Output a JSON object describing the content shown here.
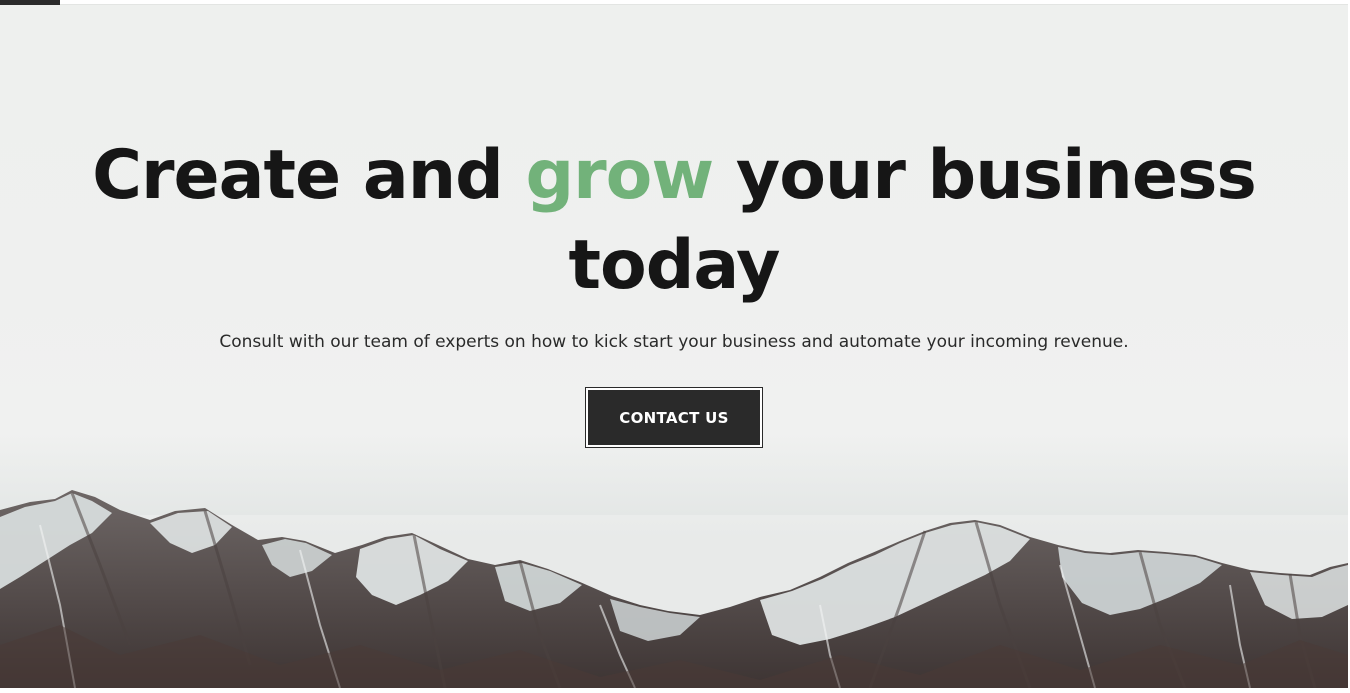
{
  "hero": {
    "headline_part1": "Create and ",
    "headline_accent": "grow",
    "headline_part2": " your business today",
    "subtitle": "Consult with our team of experts on how to kick start your business and automate your incoming revenue.",
    "cta_label": "CONTACT US"
  },
  "colors": {
    "accent": "#72b27a",
    "headline": "#161616",
    "button_bg": "#2a2a2a",
    "button_text": "#ffffff",
    "sky": "#eef0ee"
  },
  "background_image": "snow-capped-mountains"
}
